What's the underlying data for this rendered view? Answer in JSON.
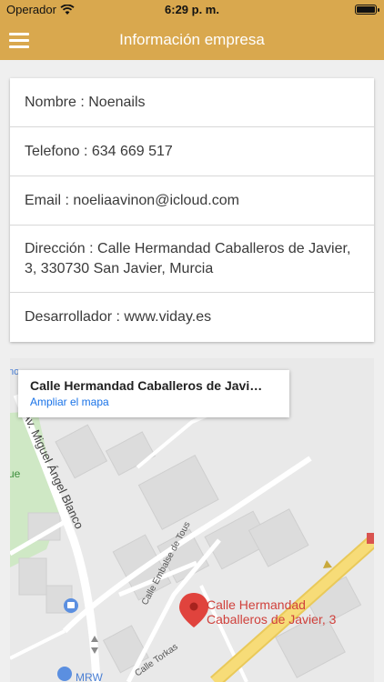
{
  "status_bar": {
    "carrier": "Operador",
    "time": "6:29 p. m."
  },
  "navbar": {
    "title": "Información empresa",
    "menu_icon": "hamburger-icon"
  },
  "info": {
    "name": "Nombre : Noenails",
    "phone": "Telefono : 634 669 517",
    "email": "Email : noeliaavinon@icloud.com",
    "address": "Dirección : Calle Hermandad Caballeros de Javier, 3, 330730 San Javier, Murcia",
    "developer": "Desarrollador : www.viday.es"
  },
  "map": {
    "place_title": "Calle Hermandad Caballeros de Javi…",
    "enlarge_link": "Ampliar el mapa",
    "pin_label_line1": "Calle Hermandad",
    "pin_label_line2": "Caballeros de Javier, 3",
    "street_labels": [
      "Av. Miguel Ángel Blanco",
      "Calle Embalse de Tous",
      "Calle Torkas"
    ],
    "poi_label": "MRW",
    "edge_labels": [
      "no",
      "ue"
    ],
    "colors": {
      "pin": "#e0433d",
      "highway": "#f5d66b",
      "park": "#cfe8c5",
      "road": "#ffffff"
    }
  },
  "colors": {
    "header": "#d9a84e",
    "link": "#1a73e8"
  }
}
